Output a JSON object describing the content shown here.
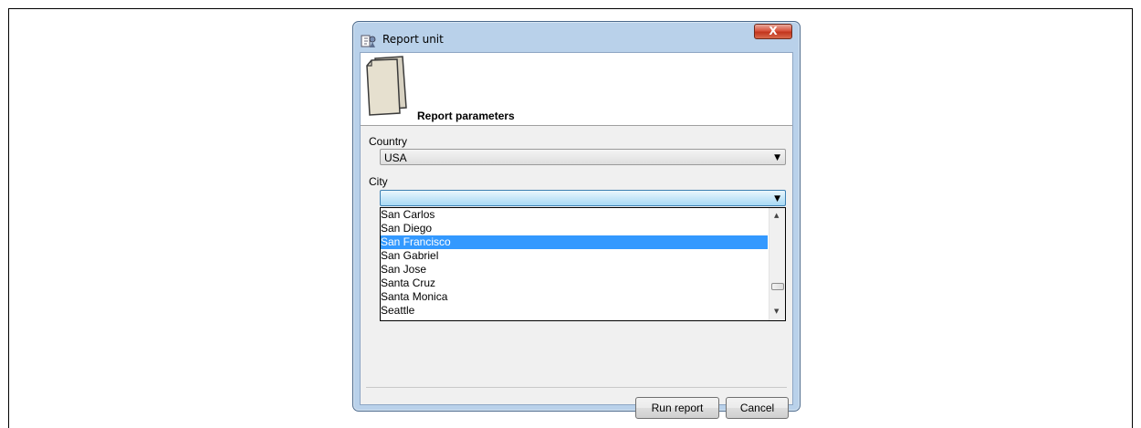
{
  "window": {
    "title": "Report unit",
    "close_label": "X"
  },
  "header": {
    "title": "Report parameters"
  },
  "country": {
    "label": "Country",
    "value": "USA"
  },
  "city": {
    "label": "City",
    "value": "",
    "options": [
      "San Carlos",
      "San Diego",
      "San Francisco",
      "San Gabriel",
      "San Jose",
      "Santa Cruz",
      "Santa Monica",
      "Seattle"
    ],
    "highlighted": "San Francisco"
  },
  "buttons": {
    "run": "Run report",
    "cancel": "Cancel"
  },
  "icons": {
    "app": "report-unit-icon",
    "header": "document-pages-icon",
    "close": "close-icon",
    "dropdown": "chevron-down-icon",
    "scroll_up": "scroll-up-icon",
    "scroll_down": "scroll-down-icon"
  }
}
